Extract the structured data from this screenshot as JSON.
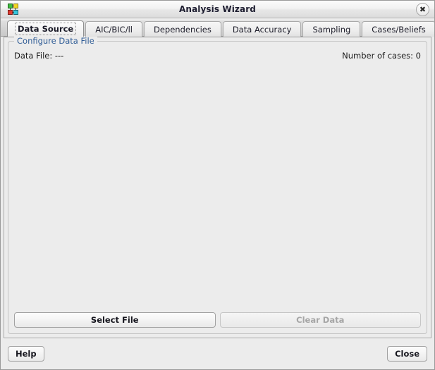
{
  "window": {
    "title": "Analysis Wizard",
    "icon": "bayesian-network-icon",
    "close_label": "✖"
  },
  "tabs": [
    {
      "label": "Data Source",
      "selected": true
    },
    {
      "label": "AIC/BIC/ll",
      "selected": false
    },
    {
      "label": "Dependencies",
      "selected": false
    },
    {
      "label": "Data Accuracy",
      "selected": false
    },
    {
      "label": "Sampling",
      "selected": false
    },
    {
      "label": "Cases/Beliefs",
      "selected": false
    }
  ],
  "data_source": {
    "group_title": "Configure Data File",
    "data_file_label": "Data File: ---",
    "number_of_cases_label": "Number of cases: 0",
    "select_file_label": "Select File",
    "clear_data_label": "Clear Data",
    "clear_data_disabled": true
  },
  "footer": {
    "help_label": "Help",
    "close_label": "Close"
  },
  "colors": {
    "window_bg": "#ececec",
    "group_title": "#2f5c96",
    "text": "#1b1b1b",
    "border": "#a9a9a9",
    "disabled_text": "#a6a6a6"
  }
}
